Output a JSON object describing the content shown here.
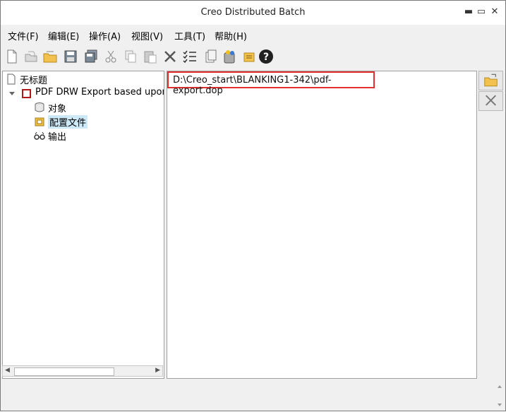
{
  "window": {
    "title": "Creo Distributed Batch"
  },
  "menu": [
    "文件(F)",
    "编辑(E)",
    "操作(A)",
    "视图(V)",
    "工具(T)",
    "帮助(H)"
  ],
  "toolbar": {
    "icons": [
      "new-file-icon",
      "open-file-icon",
      "open-folder-icon",
      "save-icon",
      "save-all-icon",
      "cut-icon",
      "copy-icon",
      "paste-icon",
      "delete-icon",
      "checklist-icon",
      "clipboard-icon",
      "run-icon",
      "settings-icon",
      "help-icon"
    ]
  },
  "tree": {
    "root": "无标题",
    "task": "PDF DRW Export based upon e",
    "objects": "对象",
    "config_files": "配置文件",
    "output": "输出"
  },
  "config": {
    "path": "D:\\Creo_start\\BLANKING1-342\\pdf-export.dop"
  }
}
